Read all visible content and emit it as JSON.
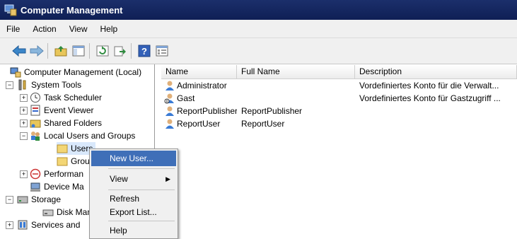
{
  "window": {
    "title": "Computer Management"
  },
  "menubar": {
    "items": [
      "File",
      "Action",
      "View",
      "Help"
    ]
  },
  "toolbar": {
    "buttons": [
      "back-icon",
      "forward-icon",
      "up-folder-icon",
      "show-hide-tree-icon",
      "refresh-icon",
      "export-list-icon",
      "help-icon",
      "properties-icon"
    ]
  },
  "tree": {
    "root": "Computer Management (Local)",
    "system_tools": "System Tools",
    "task_scheduler": "Task Scheduler",
    "event_viewer": "Event Viewer",
    "shared_folders": "Shared Folders",
    "local_users_groups": "Local Users and Groups",
    "users": "Users",
    "groups": "Group",
    "performance": "Performan",
    "device_manager": "Device Ma",
    "storage": "Storage",
    "disk_management": "Disk Mana",
    "services_apps": "Services and"
  },
  "list": {
    "columns": [
      "Name",
      "Full Name",
      "Description"
    ],
    "rows": [
      {
        "name": "Administrator",
        "full_name": "",
        "description": "Vordefiniertes Konto für die Verwalt..."
      },
      {
        "name": "Gast",
        "full_name": "",
        "description": "Vordefiniertes Konto für Gastzugriff ..."
      },
      {
        "name": "ReportPublisher",
        "full_name": "ReportPublisher",
        "description": ""
      },
      {
        "name": "ReportUser",
        "full_name": "ReportUser",
        "description": ""
      }
    ]
  },
  "context_menu": {
    "new_user": "New User...",
    "view": "View",
    "refresh": "Refresh",
    "export": "Export List...",
    "help": "Help"
  },
  "colors": {
    "titlebar": "#1b2f6b",
    "highlight": "#3f6fb8",
    "selection": "#d9e8fb"
  }
}
